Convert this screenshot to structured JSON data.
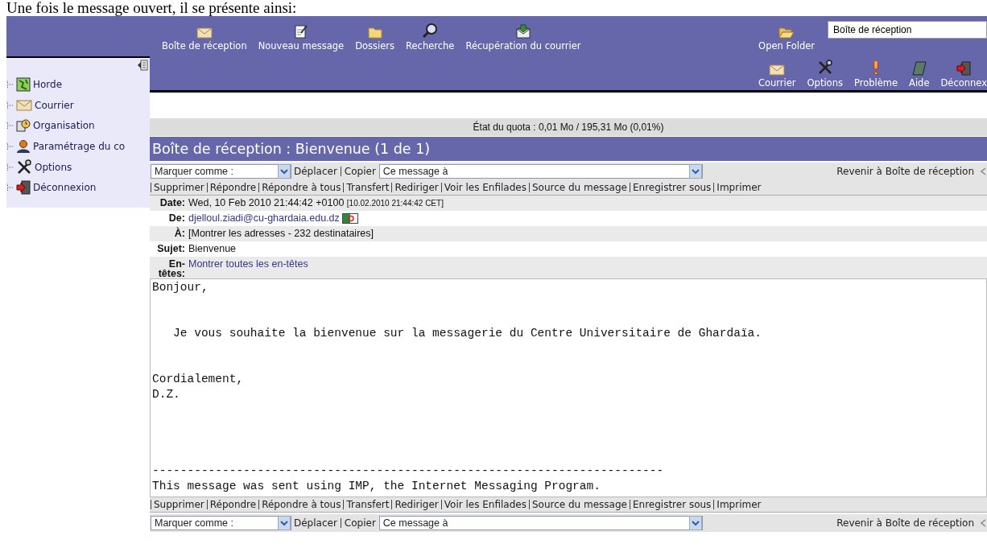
{
  "caption": "Une fois le message ouvert, il se présente ainsi:",
  "toolbar": {
    "items": [
      {
        "label": "Boîte de réception"
      },
      {
        "label": "Nouveau message"
      },
      {
        "label": "Dossiers"
      },
      {
        "label": "Recherche"
      },
      {
        "label": "Récupération du courrier"
      }
    ],
    "open_folder": "Open Folder",
    "folder_select": {
      "value": "Boîte de réception"
    }
  },
  "app_menu": [
    "Courrier",
    "Options",
    "Problème",
    "Aide",
    "Déconnex"
  ],
  "sidebar": {
    "items": [
      {
        "label": "Horde"
      },
      {
        "label": "Courrier"
      },
      {
        "label": "Organisation"
      },
      {
        "label": "Paramétrage du co"
      },
      {
        "label": "Options"
      },
      {
        "label": "Déconnexion"
      }
    ]
  },
  "quota": "État du quota : 0,01 Mo / 195,31 Mo (0,01%)",
  "title": "Boîte de réception : Bienvenue (1 de 1)",
  "top_actions": {
    "mark_select": "Marquer comme :",
    "move": "Déplacer",
    "copy": "Copier",
    "target_select": "Ce message à",
    "back": "Revenir à Boîte de réception"
  },
  "top_links": [
    "Supprimer",
    "Répondre",
    "Répondre à tous",
    "Transfert",
    "Rediriger",
    "Voir les Enfilades",
    "Source du message",
    "Enregistrer sous",
    "Imprimer"
  ],
  "headers": [
    {
      "kind": "date",
      "label": "Date:",
      "value": "Wed, 10 Feb 2010 21:44:42 +0100",
      "note": "[10.02.2010 21:44:42 CET]"
    },
    {
      "kind": "sender",
      "label": "De:",
      "value": "djelloul.ziadi@cu-ghardaia.edu.dz"
    },
    {
      "kind": "text",
      "label": "À:",
      "value": "[Montrer les adresses - 232 destinataires]"
    },
    {
      "kind": "text",
      "label": "Sujet:",
      "value": "Bienvenue"
    },
    {
      "kind": "link",
      "label": "En-têtes:",
      "value": "Montrer toutes les en-têtes"
    }
  ],
  "body": "Bonjour,\n\n\n   Je vous souhaite la bienvenue sur la messagerie du Centre Universitaire de Ghardaïa.\n\n\nCordialement,\nD.Z.\n\n\n\n\n-------------------------------------------------------------------------\nThis message was sent using IMP, the Internet Messaging Program.",
  "bottom_links": [
    "Supprimer",
    "Répondre",
    "Répondre à tous",
    "Transfert",
    "Rediriger",
    "Voir les Enfilades",
    "Source du message",
    "Enregistrer sous",
    "Imprimer"
  ],
  "bottom_actions": {
    "mark_select": "Marquer comme :",
    "move": "Déplacer",
    "copy": "Copier",
    "target_select": "Ce message à",
    "back": "Revenir à Boîte de réception"
  }
}
